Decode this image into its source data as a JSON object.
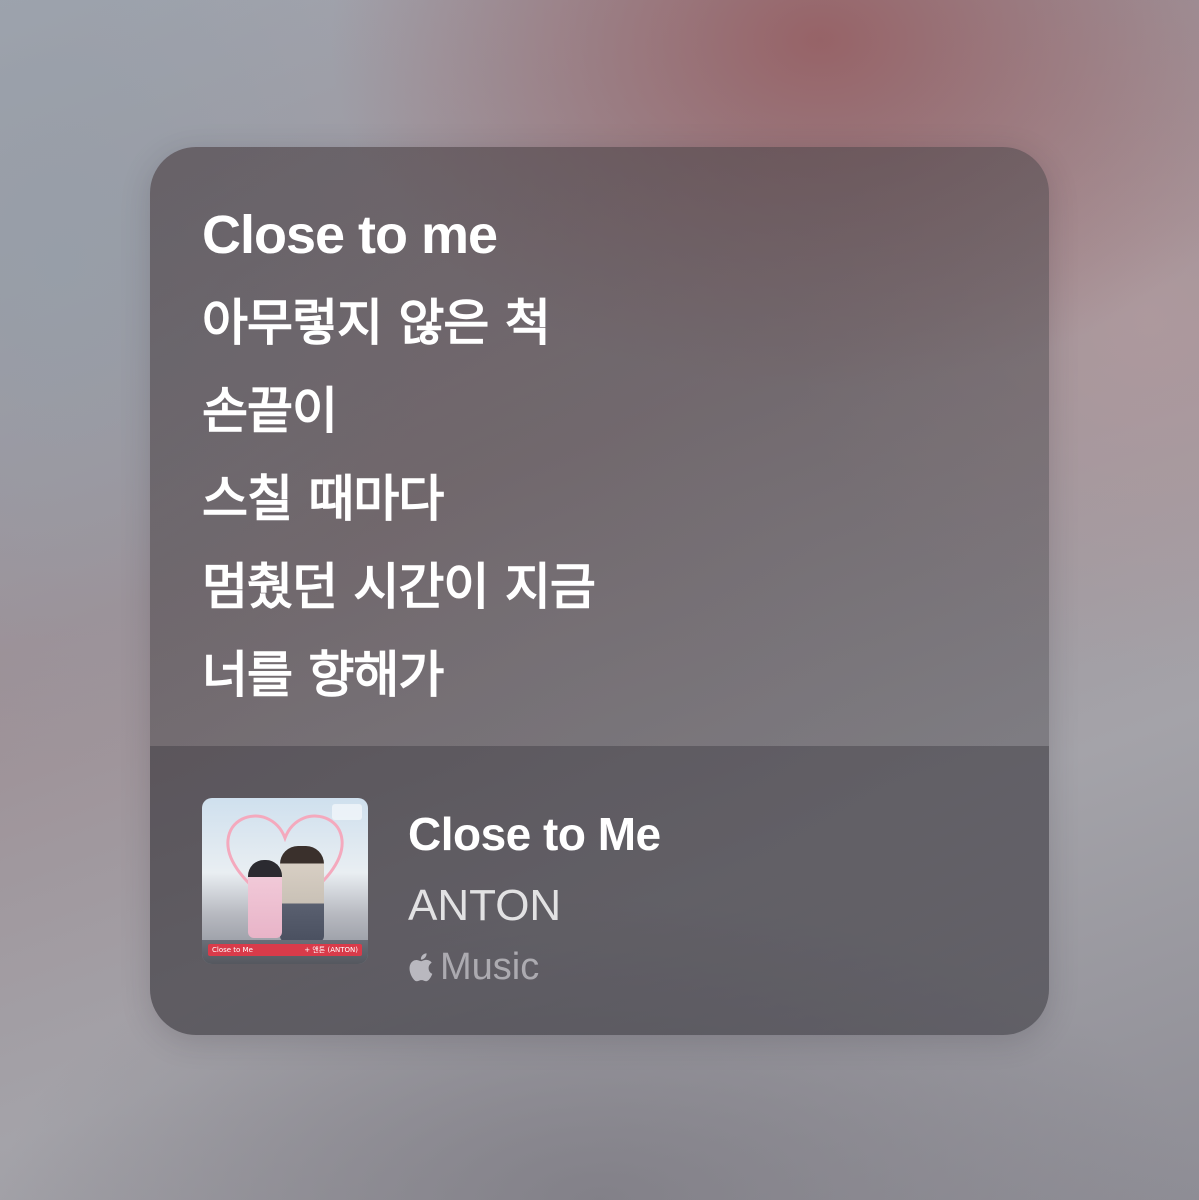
{
  "lyrics_card": {
    "lines": [
      "Close to me",
      "아무렇지 않은 척",
      "손끝이",
      "스칠 때마다",
      "멈췄던 시간이 지금",
      "너를 향해가"
    ]
  },
  "track": {
    "title": "Close to Me",
    "artist": "ANTON",
    "service_label": "Music",
    "service_icon": "apple-logo-icon",
    "artwork": {
      "title_strip": "Close to Me",
      "artist_strip": "+ 앤톤 (ANTON)"
    }
  },
  "colors": {
    "text_primary": "#ffffff",
    "text_secondary": "#e2e2e6",
    "service_tint": "#b9b8bf",
    "artwork_strip": "#d93b4a"
  }
}
